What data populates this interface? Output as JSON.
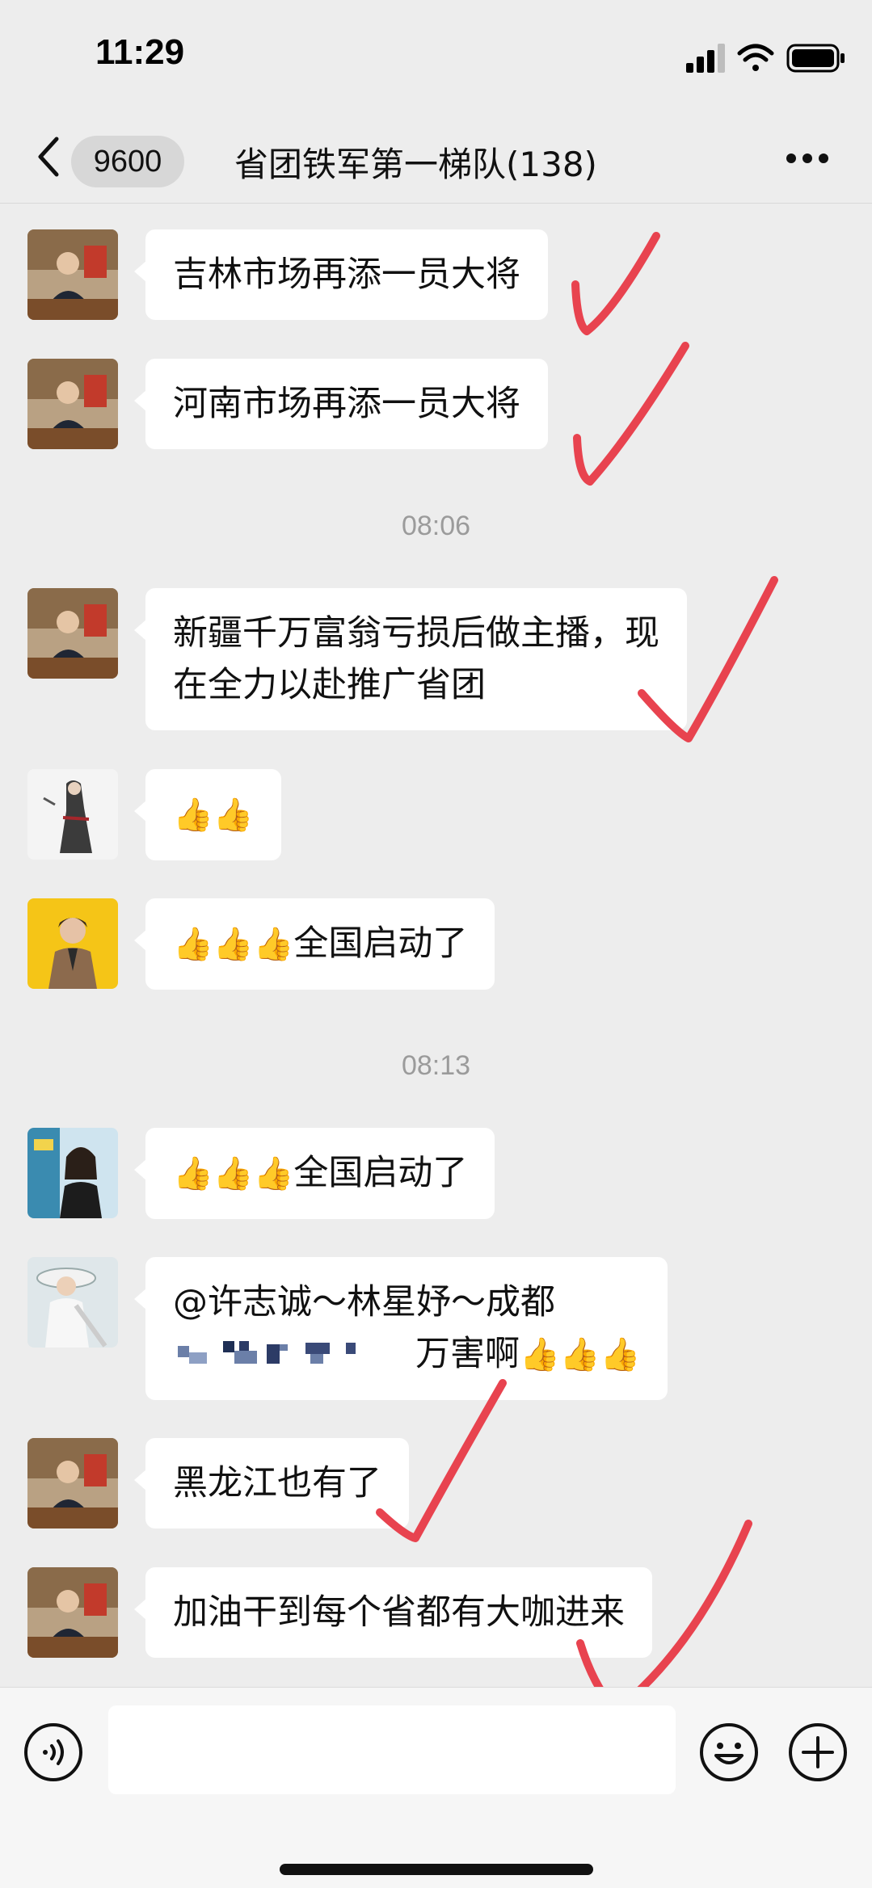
{
  "status": {
    "time": "11:29"
  },
  "nav": {
    "badge": "9600",
    "title": "省团铁军第一梯队(138)"
  },
  "messages": [
    {
      "text": "吉林市场再添一员大将"
    },
    {
      "text": "河南市场再添一员大将"
    },
    {
      "timestamp": "08:06"
    },
    {
      "line1": "新疆千万富翁亏损后做主播，现",
      "line2": "在全力以赴推广省团"
    },
    {
      "emoji": "👍👍"
    },
    {
      "emoji": "👍👍👍",
      "text": "全国启动了"
    },
    {
      "timestamp": "08:13"
    },
    {
      "emoji": "👍👍👍",
      "text": "全国启动了"
    },
    {
      "line1": "@许志诚～林星妤～成都",
      "line2_text": "万害啊",
      "line2_emoji": "👍👍👍"
    },
    {
      "text": "黑龙江也有了"
    },
    {
      "text": "加油干到每个省都有大咖进来"
    }
  ],
  "colors": {
    "check": "#e8434f",
    "bubble": "#ffffff",
    "background": "#ededed"
  },
  "icons": [
    "back-chevron-icon",
    "more-dots-icon",
    "voice-icon",
    "emoji-icon",
    "plus-icon",
    "signal-icon",
    "wifi-icon",
    "battery-icon"
  ]
}
